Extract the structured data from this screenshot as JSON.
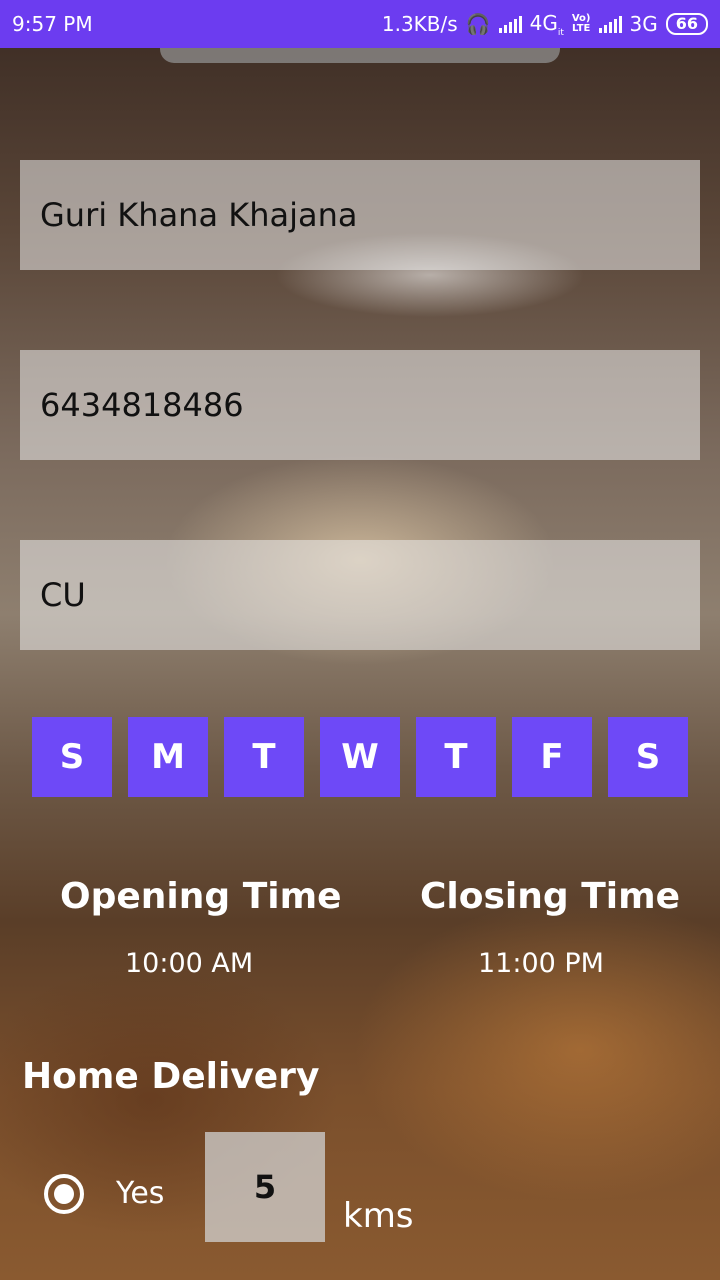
{
  "status_bar": {
    "time": "9:57 PM",
    "speed": "1.3KB/s",
    "network1": "4G",
    "network1_sub": "it",
    "volte_top": "Vo)",
    "volte_bottom": "LTE",
    "network2": "3G",
    "battery": "66"
  },
  "form": {
    "restaurant_name": "Guri Khana Khajana",
    "phone": "6434818486",
    "address": "CU"
  },
  "days": [
    "S",
    "M",
    "T",
    "W",
    "T",
    "F",
    "S"
  ],
  "hours": {
    "opening_label": "Opening Time",
    "opening_value": "10:00 AM",
    "closing_label": "Closing Time",
    "closing_value": "11:00 PM"
  },
  "delivery": {
    "title": "Home Delivery",
    "option_label": "Yes",
    "selected": true,
    "distance": "5",
    "unit": "kms"
  },
  "colors": {
    "accent": "#6c3cf0",
    "day_button": "#6e49f7"
  }
}
